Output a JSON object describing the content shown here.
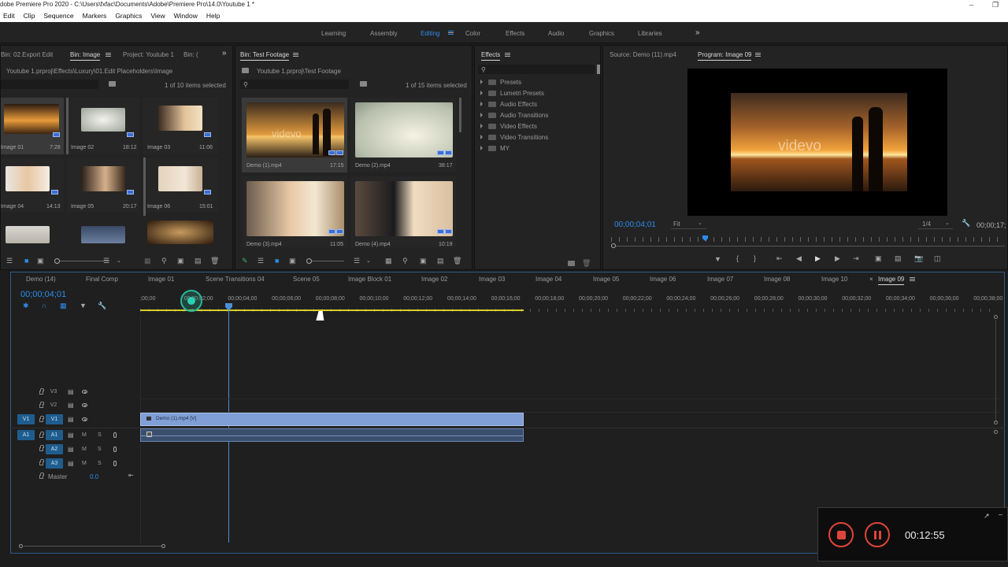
{
  "titlebar": {
    "title": "dobe Premiere Pro 2020 - C:\\Users\\fxfac\\Documents\\Adobe\\Premiere Pro\\14.0\\Youtube 1 *"
  },
  "menu": [
    "Edit",
    "Clip",
    "Sequence",
    "Markers",
    "Graphics",
    "View",
    "Window",
    "Help"
  ],
  "workspaces": [
    "Learning",
    "Assembly",
    "Editing",
    "Color",
    "Effects",
    "Audio",
    "Graphics",
    "Libraries"
  ],
  "workspace_active": "Editing",
  "project_panel": {
    "tabs": [
      "Bin: 02.Export Edit",
      "Bin: Image",
      "Project: Youtube 1",
      "Bin: ("
    ],
    "path": "Youtube 1.prproj\\Effects\\Luxury\\01.Edit Placeholders\\Image",
    "selection": "1 of 10 items selected",
    "items": [
      {
        "name": "Image 01",
        "dur": "7:28"
      },
      {
        "name": "Image 02",
        "dur": "18:12"
      },
      {
        "name": "Image 03",
        "dur": "11:06"
      },
      {
        "name": "Image 04",
        "dur": "14:13"
      },
      {
        "name": "Image 05",
        "dur": "20:17"
      },
      {
        "name": "Image 06",
        "dur": "15:01"
      }
    ]
  },
  "bin_panel": {
    "tab": "Bin: Test Footage",
    "path": "Youtube 1.prproj\\Test Footage",
    "selection": "1 of 15 items selected",
    "items": [
      {
        "name": "Demo (1).mp4",
        "dur": "17:15"
      },
      {
        "name": "Demo (2).mp4",
        "dur": "38:17"
      },
      {
        "name": "Demo (3).mp4",
        "dur": "11:05"
      },
      {
        "name": "Demo (4).mp4",
        "dur": "10:19"
      }
    ],
    "watermark": "videvo"
  },
  "effects_panel": {
    "tab": "Effects",
    "items": [
      "Presets",
      "Lumetri Presets",
      "Audio Effects",
      "Audio Transitions",
      "Video Effects",
      "Video Transitions",
      "MY"
    ]
  },
  "monitor": {
    "source_tab": "Source: Demo (11).mp4",
    "program_tab": "Program: Image 09",
    "timecode": "00;00;04;01",
    "fit": "Fit",
    "quality": "1/4",
    "end_time": "00;00;17;",
    "watermark": "videvo"
  },
  "timeline": {
    "tabs": [
      "Demo (14)",
      "Final Comp",
      "Image 01",
      "Scene Transitions 04",
      "Scene 05",
      "Image Block 01",
      "Image 02",
      "Image 03",
      "Image 04",
      "Image 05",
      "Image 06",
      "Image 07",
      "Image 08",
      "Image 10",
      "Image 09"
    ],
    "active_tab": "Image 09",
    "timecode": "00;00;04;01",
    "ruler": [
      ";00;00",
      "00;00;02;00",
      "00;00;04;00",
      "00;00;06;00",
      "00;00;08;00",
      "00;00;10;00",
      "00;00;12;00",
      "00;00;14;00",
      "00;00;16;00",
      "00;00;18;00",
      "00;00;20;00",
      "00;00;22;00",
      "00;00;24;00",
      "00;00;26;00",
      "00;00;28;00",
      "00;00;30;00",
      "00;00;32;00",
      "00;00;34;00",
      "00;00;36;00",
      "00;00;38;00"
    ],
    "video_tracks": [
      "V3",
      "V2",
      "V1"
    ],
    "audio_tracks": [
      "A1",
      "A2",
      "A3"
    ],
    "source_v": "V1",
    "source_a": "A1",
    "master_label": "Master",
    "master_value": "0.0",
    "mute": "M",
    "solo": "S",
    "clip_label": "Demo (1).mp4 [V]"
  },
  "recorder": {
    "time": "00:12:55"
  },
  "colors": {
    "accent": "#2d8ceb",
    "clip_video": "#7f9fd6",
    "clip_audio": "#3a4f6e",
    "work_area": "#d4cf2a"
  }
}
